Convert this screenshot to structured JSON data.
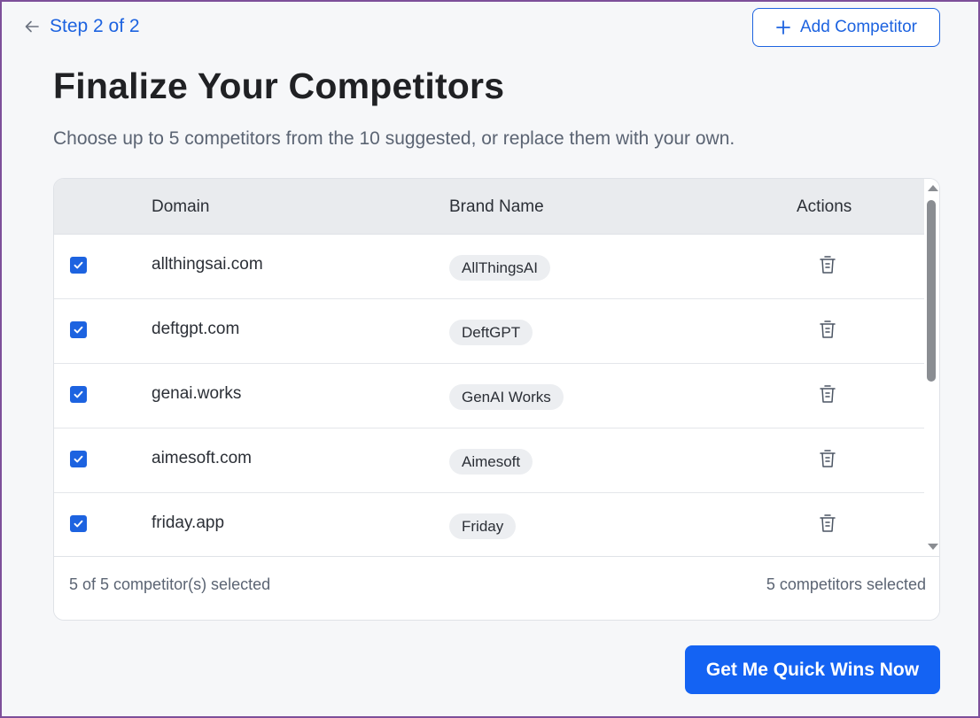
{
  "header": {
    "step_label": "Step 2 of 2",
    "add_competitor_label": "Add Competitor"
  },
  "main": {
    "title": "Finalize Your Competitors",
    "subtitle": "Choose up to 5 competitors from the 10 suggested, or replace them with your own."
  },
  "table": {
    "columns": {
      "domain": "Domain",
      "brand": "Brand Name",
      "actions": "Actions"
    },
    "rows": [
      {
        "checked": true,
        "domain": "allthingsai.com",
        "brand": "AllThingsAI"
      },
      {
        "checked": true,
        "domain": "deftgpt.com",
        "brand": "DeftGPT"
      },
      {
        "checked": true,
        "domain": "genai.works",
        "brand": "GenAI Works"
      },
      {
        "checked": true,
        "domain": "aimesoft.com",
        "brand": "Aimesoft"
      },
      {
        "checked": true,
        "domain": "friday.app",
        "brand": "Friday"
      }
    ],
    "footer_left": "5 of 5 competitor(s) selected",
    "footer_right": "5 competitors selected"
  },
  "cta": {
    "label": "Get Me Quick Wins Now"
  },
  "icons": {
    "back": "arrow-left-icon",
    "add": "plus-icon",
    "row_action": "trash-icon",
    "checkbox": "checkmark-icon"
  },
  "colors": {
    "accent": "#1d63e0",
    "cta": "#1463f3",
    "frame_border": "#7d4f9a"
  }
}
